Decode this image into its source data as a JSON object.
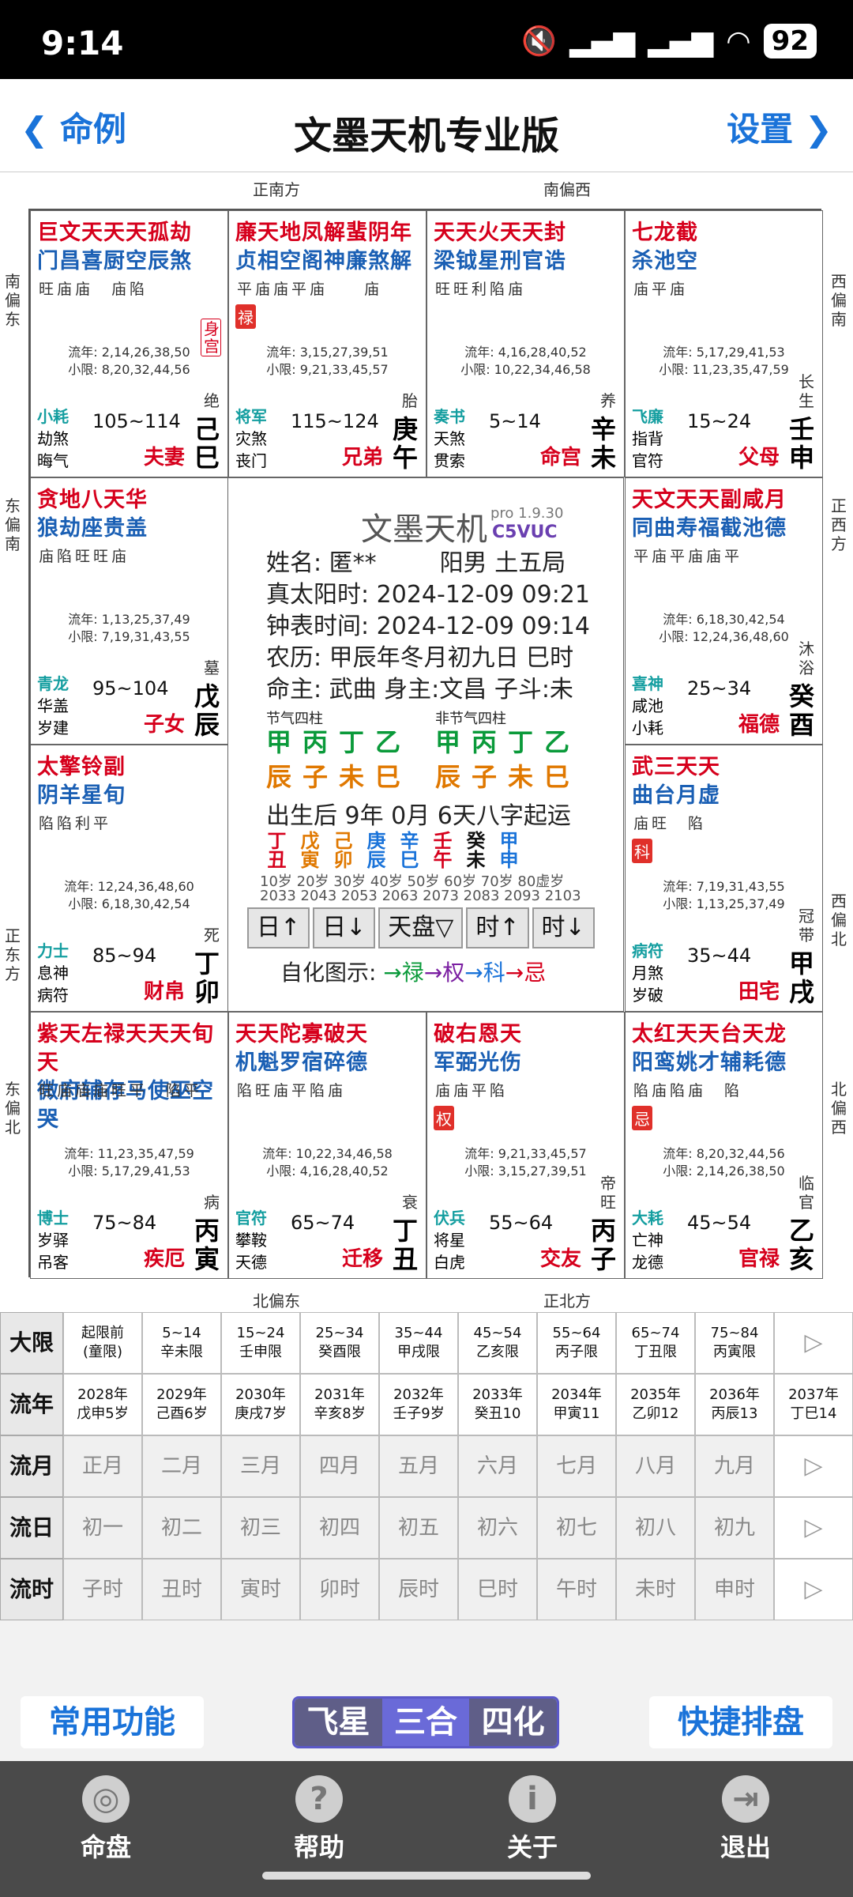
{
  "status": {
    "time": "9:14",
    "battery": "92"
  },
  "nav": {
    "back": "命例",
    "title": "文墨天机专业版",
    "settings": "设置"
  },
  "directions": {
    "top_left": "正南方",
    "top_right": "南偏西",
    "bottom_left": "北偏东",
    "bottom_right": "正北方",
    "l1": "南偏东",
    "l2": "东偏南",
    "l3": "正东方",
    "l4": "东偏北",
    "r1": "西偏南",
    "r2": "正西方",
    "r3": "西偏北",
    "r4": "北偏西"
  },
  "palaces": [
    {
      "s1": "巨文天天天孤劫",
      "s2": "门昌喜厨空辰煞",
      "b": "旺庙庙　庙陷",
      "ly": "流年: 2,14,26,38,50",
      "xx": "小限: 8,20,32,44,56",
      "g1": "小耗",
      "g2": "劫煞",
      "g3": "晦气",
      "ages": "105~114",
      "pn": "夫妻",
      "st1": "己",
      "st2": "巳",
      "ds": "绝",
      "extra": "身宫"
    },
    {
      "s1": "廉天地凤解蜚阴年",
      "s2": "贞相空阁神廉煞解",
      "b": "平庙庙平庙　　庙",
      "ly": "流年: 3,15,27,39,51",
      "xx": "小限: 9,21,33,45,57",
      "g1": "将军",
      "g2": "灾煞",
      "g3": "丧门",
      "ages": "115~124",
      "pn": "兄弟",
      "st1": "庚",
      "st2": "午",
      "ds": "胎",
      "hua": "禄"
    },
    {
      "s1": "天天火天天封",
      "s2": "梁钺星刑官诰",
      "b": "旺旺利陷庙",
      "ly": "流年: 4,16,28,40,52",
      "xx": "小限: 10,22,34,46,58",
      "g1": "奏书",
      "g2": "天煞",
      "g3": "贯索",
      "ages": "5~14",
      "pn": "命宫",
      "st1": "辛",
      "st2": "未",
      "ds": "养"
    },
    {
      "s1": "七龙截",
      "s2": "杀池空",
      "b": "庙平庙",
      "ly": "流年: 5,17,29,41,53",
      "xx": "小限: 11,23,35,47,59",
      "g1": "飞廉",
      "g2": "指背",
      "g3": "官符",
      "ages": "15~24",
      "pn": "父母",
      "st1": "壬",
      "st2": "申",
      "ds": "长生"
    },
    {
      "s1": "贪地八天华",
      "s2": "狼劫座贵盖",
      "b": "庙陷旺旺庙",
      "ly": "流年: 1,13,25,37,49",
      "xx": "小限: 7,19,31,43,55",
      "g1": "青龙",
      "g2": "华盖",
      "g3": "岁建",
      "ages": "95~104",
      "pn": "子女",
      "st1": "戊",
      "st2": "辰",
      "ds": "墓"
    },
    {
      "s1": "天文天天副咸月",
      "s2": "同曲寿福截池德",
      "b": "平庙平庙庙平",
      "ly": "流年: 6,18,30,42,54",
      "xx": "小限: 12,24,36,48,60",
      "g1": "喜神",
      "g2": "咸池",
      "g3": "小耗",
      "ages": "25~34",
      "pn": "福德",
      "st1": "癸",
      "st2": "酉",
      "ds": "沐浴"
    },
    {
      "s1": "太擎铃副",
      "s2": "阴羊星旬",
      "b": "陷陷利平",
      "ly": "流年: 12,24,36,48,60",
      "xx": "小限: 6,18,30,42,54",
      "g1": "力士",
      "g2": "息神",
      "g3": "病符",
      "ages": "85~94",
      "pn": "财帛",
      "st1": "丁",
      "st2": "卯",
      "ds": "死"
    },
    {
      "s1": "武三天天",
      "s2": "曲台月虚",
      "b": "庙旺　陷",
      "ly": "流年: 7,19,31,43,55",
      "xx": "小限: 1,13,25,37,49",
      "g1": "病符",
      "g2": "月煞",
      "g3": "岁破",
      "ages": "35~44",
      "pn": "田宅",
      "st1": "甲",
      "st2": "戌",
      "ds": "冠带",
      "hua": "科"
    },
    {
      "s1": "紫天左禄天天天旬天",
      "s2": "微府辅存马使巫空哭",
      "b": "旺庙庙庙旺平　陷平",
      "ly": "流年: 11,23,35,47,59",
      "xx": "小限: 5,17,29,41,53",
      "g1": "博士",
      "g2": "岁驿",
      "g3": "吊客",
      "ages": "75~84",
      "pn": "疾厄",
      "st1": "丙",
      "st2": "寅",
      "ds": "病"
    },
    {
      "s1": "天天陀寡破天",
      "s2": "机魁罗宿碎德",
      "b": "陷旺庙平陷庙",
      "ly": "流年: 10,22,34,46,58",
      "xx": "小限: 4,16,28,40,52",
      "g1": "官符",
      "g2": "攀鞍",
      "g3": "天德",
      "ages": "65~74",
      "pn": "迁移",
      "st1": "丁",
      "st2": "丑",
      "ds": "衰"
    },
    {
      "s1": "破右恩天",
      "s2": "军弼光伤",
      "b": "庙庙平陷",
      "ly": "流年: 9,21,33,45,57",
      "xx": "小限: 3,15,27,39,51",
      "g1": "伏兵",
      "g2": "将星",
      "g3": "白虎",
      "ages": "55~64",
      "pn": "交友",
      "st1": "丙",
      "st2": "子",
      "ds": "帝旺",
      "hua": "权"
    },
    {
      "s1": "太红天天台天龙",
      "s2": "阳鸾姚才辅耗德",
      "b": "陷庙陷庙　陷",
      "ly": "流年: 8,20,32,44,56",
      "xx": "小限: 2,14,26,38,50",
      "g1": "大耗",
      "g2": "亡神",
      "g3": "龙德",
      "ages": "45~54",
      "pn": "官禄",
      "st1": "乙",
      "st2": "亥",
      "ds": "临官",
      "hua": "忌"
    }
  ],
  "center": {
    "title": "文墨天机",
    "ver": "pro 1.9.30",
    "code": "C5VUC",
    "name": "姓名: 匿**",
    "gender": "阳男 土五局",
    "sun": "真太阳时: 2024-12-09 09:21",
    "clock": "钟表时间: 2024-12-09 09:14",
    "lunar": "农历: 甲辰年冬月初九日 巳时",
    "ming": "命主: 武曲 身主:文昌 子斗:未",
    "bz1_label": "节气四柱",
    "bz2_label": "非节气四柱",
    "bz1_top": "甲丙丁乙",
    "bz1_bot": "辰子未巳",
    "bz2_top": "甲丙丁乙",
    "bz2_bot": "辰子未巳",
    "qiyun": "出生后 9年 0月 6天八字起运",
    "dayun": [
      "丁丑",
      "戊寅",
      "己卯",
      "庚辰",
      "辛巳",
      "壬午",
      "癸未",
      "甲申"
    ],
    "dayun_ages": "10岁 20岁 30岁 40岁 50岁 60岁 70岁 80虚岁",
    "dayun_years": "2033 2043 2053 2063 2073 2083 2093 2103",
    "btns": [
      "日↑",
      "日↓",
      "天盘▽",
      "时↑",
      "时↓"
    ],
    "hua_label": "自化图示:",
    "hua_lu": "→禄",
    "hua_quan": "→权",
    "hua_ke": "→科",
    "hua_ji": "→忌"
  },
  "table": {
    "dx_label": "大限",
    "dx": [
      [
        "起限前",
        "(童限)"
      ],
      [
        "5~14",
        "辛未限"
      ],
      [
        "15~24",
        "壬申限"
      ],
      [
        "25~34",
        "癸酉限"
      ],
      [
        "35~44",
        "甲戌限"
      ],
      [
        "45~54",
        "乙亥限"
      ],
      [
        "55~64",
        "丙子限"
      ],
      [
        "65~74",
        "丁丑限"
      ],
      [
        "75~84",
        "丙寅限"
      ]
    ],
    "ln_label": "流年",
    "ln": [
      [
        "2028年",
        "戊申5岁"
      ],
      [
        "2029年",
        "己酉6岁"
      ],
      [
        "2030年",
        "庚戌7岁"
      ],
      [
        "2031年",
        "辛亥8岁"
      ],
      [
        "2032年",
        "壬子9岁"
      ],
      [
        "2033年",
        "癸丑10"
      ],
      [
        "2034年",
        "甲寅11"
      ],
      [
        "2035年",
        "乙卯12"
      ],
      [
        "2036年",
        "丙辰13"
      ],
      [
        "2037年",
        "丁巳14"
      ]
    ],
    "ly_label": "流月",
    "ly": [
      "正月",
      "二月",
      "三月",
      "四月",
      "五月",
      "六月",
      "七月",
      "八月",
      "九月"
    ],
    "lr_label": "流日",
    "lr": [
      "初一",
      "初二",
      "初三",
      "初四",
      "初五",
      "初六",
      "初七",
      "初八",
      "初九"
    ],
    "ls_label": "流时",
    "ls": [
      "子时",
      "丑时",
      "寅时",
      "卯时",
      "辰时",
      "巳时",
      "午时",
      "未时",
      "申时"
    ]
  },
  "bottom": {
    "common": "常用功能",
    "seg1": "飞星",
    "seg2": "三合",
    "seg3": "四化",
    "quick": "快捷排盘"
  },
  "tabs": {
    "t1": "命盘",
    "t2": "帮助",
    "t3": "关于",
    "t4": "退出"
  }
}
